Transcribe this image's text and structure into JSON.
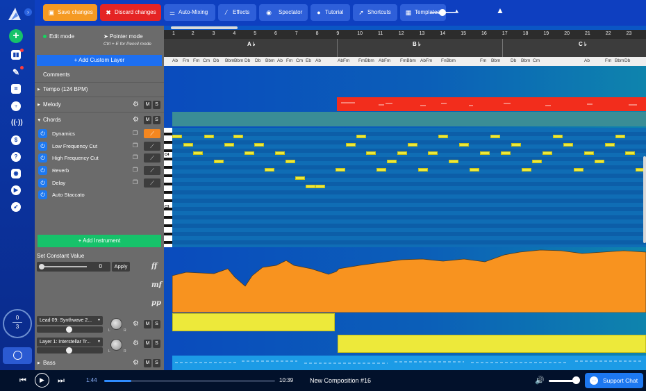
{
  "colors": {
    "accent": "#1d78f0",
    "save": "#f59a23",
    "discard": "#e52424",
    "green": "#16c26a",
    "note": "#ede93a",
    "melody": "#f22d1c",
    "automation": "#f8931f"
  },
  "toolbar": {
    "save_label": "Save changes",
    "discard_label": "Discard changes",
    "automixing_label": "Auto-Mixing",
    "effects_label": "Effects",
    "spectator_label": "Spectator",
    "tutorial_label": "Tutorial",
    "shortcuts_label": "Shortcuts",
    "templates_label": "Templates",
    "zoom_level": 0.45
  },
  "rail": {
    "counter_top": "0",
    "counter_bottom": "3"
  },
  "modes": {
    "edit": "Edit mode",
    "pointer": "Pointer mode",
    "pointer_hint": "Ctrl + E for Pencil mode"
  },
  "panel": {
    "add_custom_layer": "+ Add Custom Layer",
    "comments": "Comments",
    "tempo": "Tempo (124 BPM)",
    "melody": "Melody",
    "chords": "Chords",
    "mute": "M",
    "solo": "S",
    "effects": [
      "Dynamics",
      "Low Frequency Cut",
      "High Frequency Cut",
      "Reverb",
      "Delay",
      "Auto Staccato"
    ],
    "add_instrument": "+ Add Instrument",
    "set_constant_value": "Set Constant Value",
    "constant_value": "0",
    "apply": "Apply",
    "dynamics_marks": [
      "ff",
      "mf",
      "pp"
    ],
    "instruments": [
      {
        "name": "Lead 09: Synthwave 2...",
        "volume": 0.47
      },
      {
        "name": "Layer 1: Interstellar Tr...",
        "volume": 0.47
      }
    ],
    "knob_l": "L",
    "knob_r": "R",
    "bass": "Bass"
  },
  "timeline": {
    "bars": [
      "1",
      "2",
      "3",
      "4",
      "5",
      "6",
      "7",
      "8",
      "9",
      "10",
      "11",
      "12",
      "13",
      "14",
      "15",
      "16",
      "17",
      "18",
      "19",
      "20",
      "21",
      "22",
      "23"
    ],
    "sections": [
      "A",
      "B",
      "C"
    ],
    "chords": [
      "Ab",
      "Fm",
      "Fm",
      "Cm",
      "Db",
      "Bbm",
      "Bbm",
      "Db",
      "Db",
      "Bbm",
      "Ab",
      "Fm",
      "Cm",
      "Eb",
      "Ab",
      "AbFm",
      "FmBbm",
      "AbFm",
      "FmBbm",
      "AbFm",
      "FnBbm",
      "Fm",
      "Bbm",
      "Db",
      "Bbm",
      "Cm",
      "Ab",
      "Fm",
      "Bbm",
      "Db"
    ],
    "key_labels": [
      "C4",
      "C3"
    ]
  },
  "transport": {
    "current_time": "1:44",
    "total_time": "10:39",
    "progress": 0.16,
    "composition_title": "New Composition #16",
    "support_chat": "Support Chat",
    "volume": 0.85
  }
}
